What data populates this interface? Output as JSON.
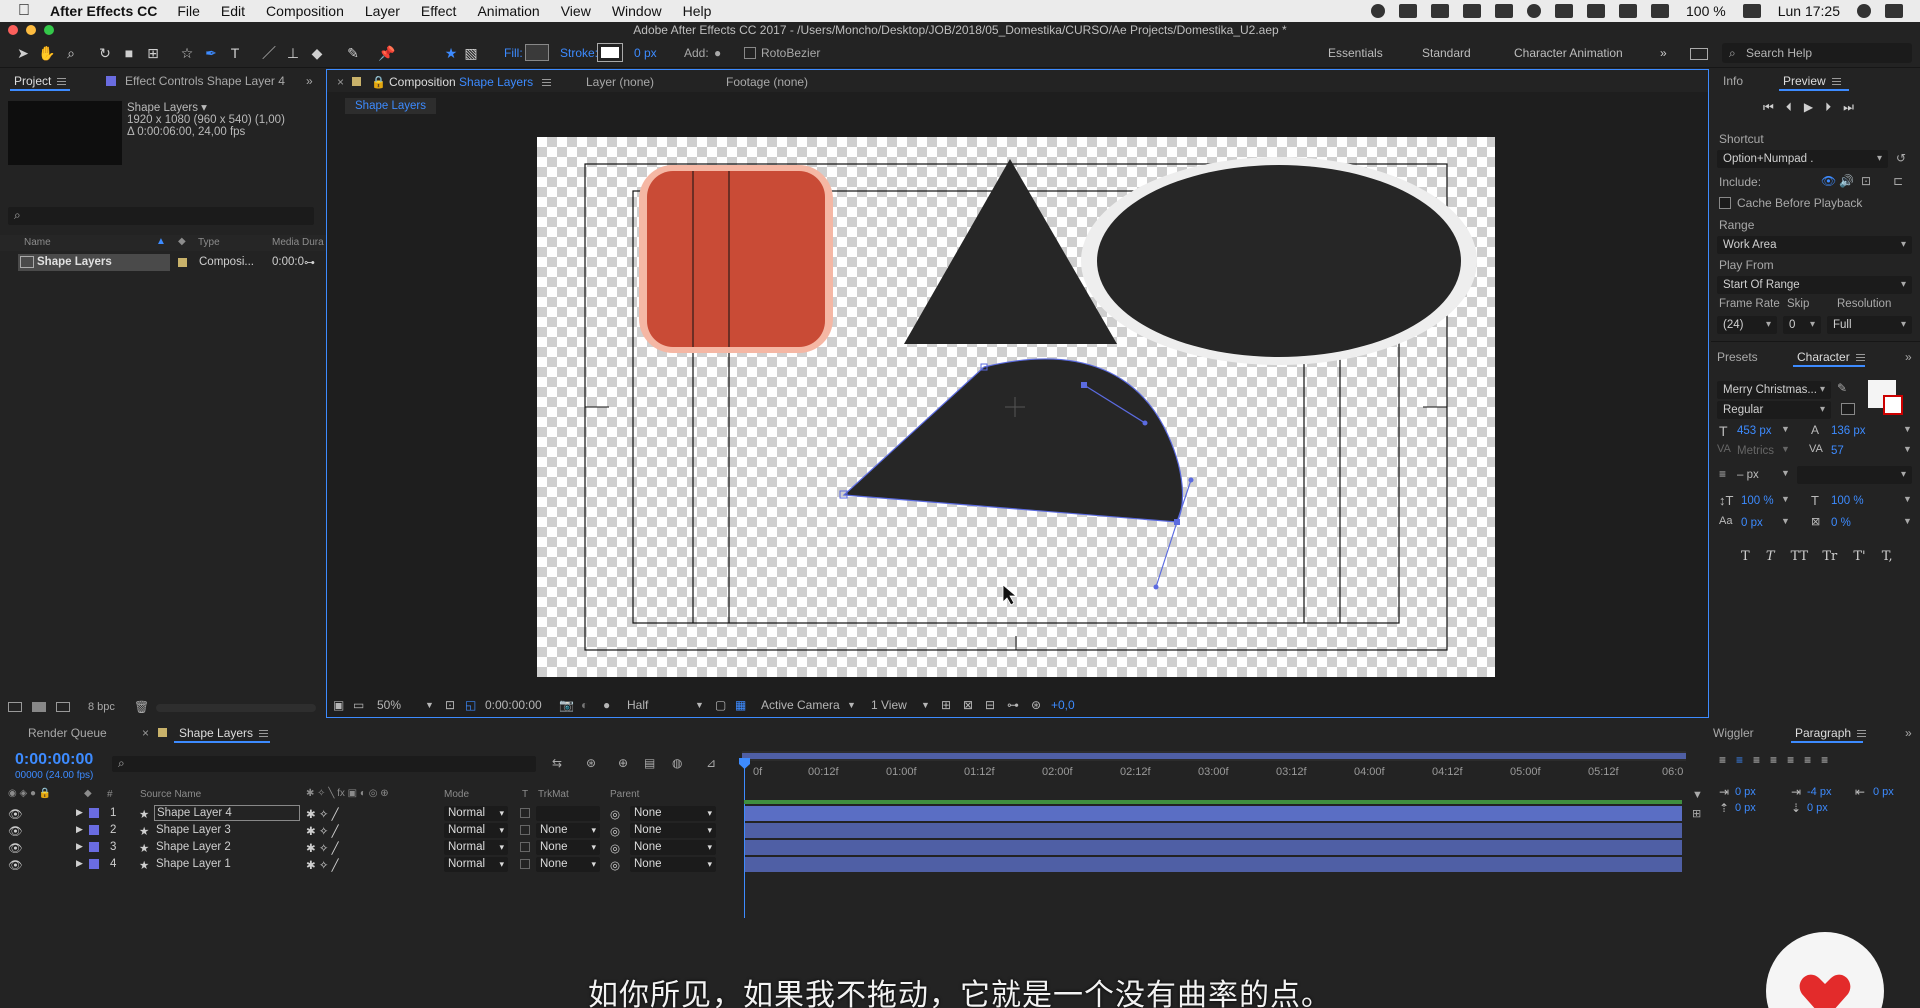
{
  "menubar": {
    "app_name": "After Effects CC",
    "menus": [
      "File",
      "Edit",
      "Composition",
      "Layer",
      "Effect",
      "Animation",
      "View",
      "Window",
      "Help"
    ],
    "battery": "100 %",
    "clock": "Lun 17:25"
  },
  "window_title": "Adobe After Effects CC 2017 - /Users/Moncho/Desktop/JOB/2018/05_Domestika/CURSO/Ae Projects/Domestika_U2.aep *",
  "toolbar": {
    "fill_label": "Fill:",
    "stroke_label": "Stroke:",
    "stroke_width": "0 px",
    "add_label": "Add:",
    "rotobezier_label": "RotoBezier",
    "workspaces": [
      "Essentials",
      "Standard",
      "Character Animation"
    ],
    "search_placeholder": "Search Help"
  },
  "project_panel": {
    "tab_project": "Project",
    "tab_effect_controls": "Effect Controls Shape Layer 4",
    "comp_name": "Shape Layers ▾",
    "comp_size": "1920 x 1080  (960 x 540) (1,00)",
    "comp_duration": "Δ 0:00:06:00, 24,00 fps",
    "columns": [
      "Name",
      "Type",
      "Media Dura"
    ],
    "item_name": "Shape Layers",
    "item_type": "Composi...",
    "item_duration": "0:00:0",
    "bit_depth": "8 bpc"
  },
  "viewer": {
    "tab_composition_prefix": "Composition",
    "tab_composition_name": "Shape Layers",
    "tab_layer": "Layer (none)",
    "tab_footage": "Footage (none)",
    "subtab": "Shape Layers",
    "zoom": "50%",
    "timecode": "0:00:00:00",
    "resolution": "Half",
    "camera": "Active Camera",
    "views": "1 View",
    "exposure": "+0,0"
  },
  "right_panel": {
    "tab_info": "Info",
    "tab_preview": "Preview",
    "shortcut_label": "Shortcut",
    "shortcut_value": "Option+Numpad .",
    "include_label": "Include:",
    "cache_label": "Cache Before Playback",
    "range_label": "Range",
    "range_value": "Work Area",
    "play_from_label": "Play From",
    "play_from_value": "Start Of Range",
    "frame_rate_label": "Frame Rate",
    "skip_label": "Skip",
    "resolution_label": "Resolution",
    "frame_rate_value": "(24)",
    "skip_value": "0",
    "resolution_value": "Full",
    "tab_presets": "Presets",
    "tab_character": "Character",
    "font_name": "Merry Christmas...",
    "font_style": "Regular",
    "font_size": "453 px",
    "leading": "136 px",
    "kerning": "Metrics",
    "tracking": "57",
    "stroke_width": "– px",
    "vert_scale": "100 %",
    "horiz_scale": "100 %",
    "baseline": "0 px",
    "tsume": "0 %",
    "type_styles": [
      "T",
      "T",
      "TT",
      "Tr",
      "T'",
      "T,"
    ]
  },
  "timeline": {
    "tab_render_queue": "Render Queue",
    "tab_comp": "Shape Layers",
    "timecode": "0:00:00:00",
    "timecode_sub": "00000 (24.00 fps)",
    "col_source": "Source Name",
    "col_mode": "Mode",
    "col_t": "T",
    "col_trkmat": "TrkMat",
    "col_parent": "Parent",
    "ruler_marks": [
      "0f",
      "00:12f",
      "01:00f",
      "01:12f",
      "02:00f",
      "02:12f",
      "03:00f",
      "03:12f",
      "04:00f",
      "04:12f",
      "05:00f",
      "05:12f",
      "06:0"
    ],
    "layers": [
      {
        "num": "1",
        "name": "Shape Layer 4",
        "mode": "Normal",
        "trkmat": "",
        "parent": "None"
      },
      {
        "num": "2",
        "name": "Shape Layer 3",
        "mode": "Normal",
        "trkmat": "None",
        "parent": "None"
      },
      {
        "num": "3",
        "name": "Shape Layer 2",
        "mode": "Normal",
        "trkmat": "None",
        "parent": "None"
      },
      {
        "num": "4",
        "name": "Shape Layer 1",
        "mode": "Normal",
        "trkmat": "None",
        "parent": "None"
      }
    ]
  },
  "paragraph_panel": {
    "tab_wiggler": "Wiggler",
    "tab_paragraph": "Paragraph",
    "indent_left": "0 px",
    "indent_first": "-4 px",
    "indent_right": "0 px",
    "space_before": "0 px",
    "space_after": "0 px"
  },
  "subtitle": "如你所见，如果我不拖动，它就是一个没有曲率的点。",
  "colors": {
    "accent_blue": "#3d8bff",
    "shape_red": "#c94b36",
    "shape_glow": "#f5b7a4",
    "shape_dark": "#262626",
    "layer_bar": "#4f5fa5",
    "panel_bg": "#232323"
  }
}
